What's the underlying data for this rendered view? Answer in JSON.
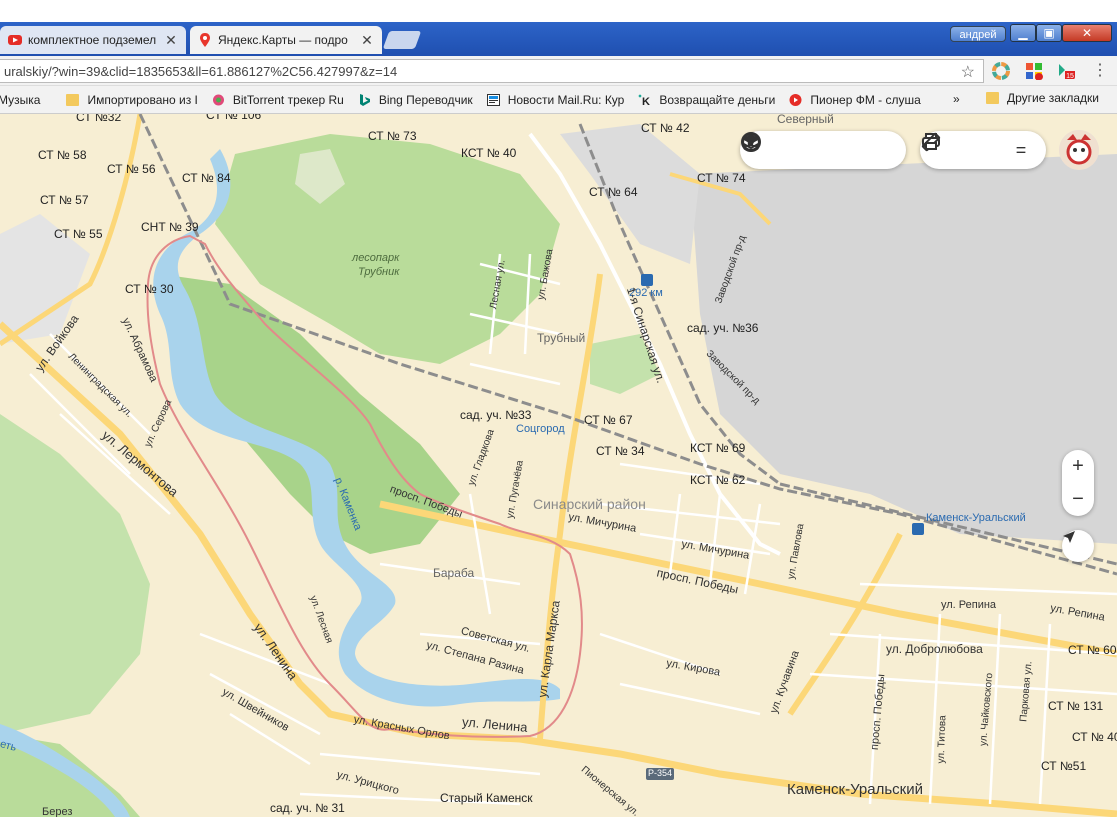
{
  "browser": {
    "tabs": [
      {
        "title": "комплектное подземел",
        "favicon": "youtube-icon"
      },
      {
        "title": "Яндекс.Карты — подро",
        "favicon": "yandex-maps-pin-icon"
      }
    ],
    "user_label": "андрей",
    "address": "uralskiy/?win=39&clid=1835653&ll=61.886127%2C56.427997&z=14"
  },
  "bookmarks": {
    "items": [
      {
        "label": "Музыка",
        "icon": "folder-icon"
      },
      {
        "label": "Импортировано из I",
        "icon": "folder-icon"
      },
      {
        "label": "BitTorrent трекер Ru",
        "icon": "bittorrent-icon"
      },
      {
        "label": "Bing Переводчик",
        "icon": "bing-icon"
      },
      {
        "label": "Новости Mail.Ru: Кур",
        "icon": "mail-ru-icon"
      },
      {
        "label": "Возвращайте деньги",
        "icon": "cashback-icon"
      },
      {
        "label": "Пионер ФМ - слуша",
        "icon": "youtube-icon"
      }
    ],
    "more": "»",
    "other": "Другие закладки"
  },
  "map": {
    "labels": {
      "st32": "СТ №32",
      "st106": "СТ № 106",
      "st73": "СТ № 73",
      "st42": "СТ № 42",
      "severny": "Северный",
      "st58": "СТ № 58",
      "st56": "СТ № 56",
      "st84": "СТ № 84",
      "kst40": "КСТ № 40",
      "st74": "СТ № 74",
      "st64": "СТ № 64",
      "st57": "СТ № 57",
      "snt39": "СНТ № 39",
      "st55": "СТ № 55",
      "lesopark1": "лесопарк",
      "lesopark2": "Трубник",
      "km292": "292 км",
      "st30": "СТ № 30",
      "sad36": "сад. уч. №36",
      "trubny": "Трубный",
      "sad33": "сад. уч. №33",
      "st67": "СТ № 67",
      "socgorod": "Соцгород",
      "st34": "СТ № 34",
      "kst69": "КСТ № 69",
      "kst62": "КСТ № 62",
      "sinarsky": "Синарский район",
      "kamensk_station": "Каменск-Уральский",
      "baraba": "Бараба",
      "st60": "СТ № 60",
      "st131": "СТ № 131",
      "st40": "СТ № 40",
      "st51": "СТ №51",
      "kamensk_city": "Каменск-Уральский",
      "stary": "Старый Каменск",
      "sad31": "сад. уч. № 31",
      "r354": "Р-354",
      "beres": "Берез"
    },
    "streets": {
      "voykova": "ул. Войкова",
      "abramova": "ул. Абрамова",
      "leningradskaya": "Ленинградская ул.",
      "lermontova": "ул. Лермонтова",
      "serova": "ул. Серова",
      "kamenka": "р. Каменка",
      "lesnaya": "Лесная ул.",
      "bazhova": "ул. Бажова",
      "sinarskaya": "1-я Синарская ул.",
      "zavodskoy_pr": "Заводской пр-д",
      "zavodskoy": "Заводской пр-д",
      "gladkova": "ул. Гладкова",
      "pugacheva": "ул. Пугачёва",
      "pobedy1": "просп. Победы",
      "michurina1": "ул. Мичурина",
      "michurina2": "ул. Мичурина",
      "pavlova": "ул. Павлова",
      "pobedy2": "просп. Победы",
      "repina1": "ул. Репина",
      "repina2": "ул. Репина",
      "lenina1": "ул. Ленина",
      "lesnaya2": "ул. Лесная",
      "karla_marksa": "ул. Карла Маркса",
      "sovetskaya": "Советская ул.",
      "razina": "ул. Степана Разина",
      "kirova": "ул. Кирова",
      "kuchavina": "ул. Кучавина",
      "dobrolyubova": "ул. Добролюбова",
      "pobedy3": "просп. Победы",
      "titova": "ул. Титова",
      "chaykovskogo": "ул. Чайковского",
      "parkovaya": "Парковая ул.",
      "shveynikov": "ул. Швейников",
      "krasnyh_orlov": "ул. Красных Орлов",
      "lenina2": "ул. Ленина",
      "uritskogo": "ул. Урицкого",
      "pionerskaya": "Пионерская ул.",
      "set": "еть"
    },
    "controls": {
      "zoom_in": "+",
      "zoom_out": "−",
      "menu": "="
    },
    "colors": {
      "land": "#f7eed3",
      "water": "#a9d3ec",
      "forest": "#b9dc9a",
      "industrial": "#d9d9d9",
      "route": "#e28a8a",
      "railway": "#9a9a9a",
      "road_major": "#fcd778"
    }
  }
}
